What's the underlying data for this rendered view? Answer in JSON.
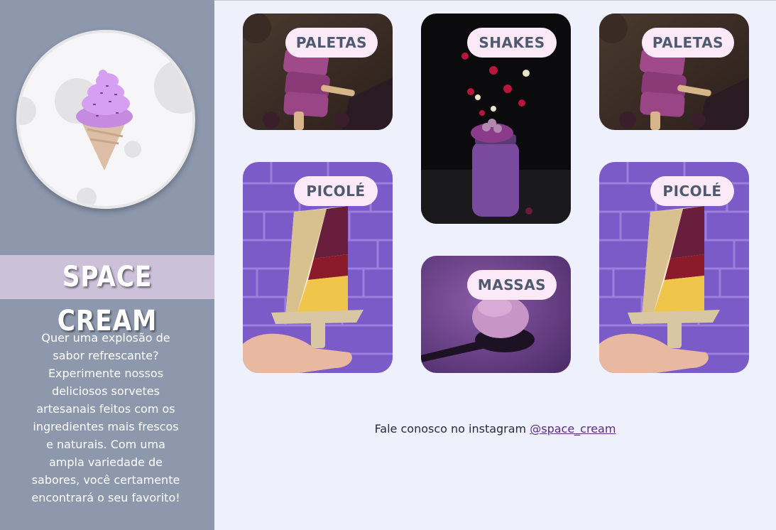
{
  "brand": {
    "name": "SPACE CREAM",
    "description": "Quer uma explosão de sabor refrescante? Experimente nossos deliciosos sorvetes artesanais feitos com os ingredientes mais frescos e naturais. Com uma ampla variedade de sabores, você certamente encontrará o seu favorito!"
  },
  "cards": [
    {
      "label": "PALETAS",
      "image": "paletas-photo"
    },
    {
      "label": "SHAKES",
      "image": "shakes-photo"
    },
    {
      "label": "PALETAS",
      "image": "paletas-photo"
    },
    {
      "label": "PICOLÉ",
      "image": "picole-photo"
    },
    {
      "label": "MASSAS",
      "image": "massas-photo"
    },
    {
      "label": "PICOLÉ",
      "image": "picole-photo"
    }
  ],
  "footer": {
    "text": "Fale conosco no instagram ",
    "instagram_handle": "@space_cream"
  },
  "colors": {
    "sidebar": "#8d98ad",
    "brand_band": "#cdc1da",
    "page_background": "#eef0fb",
    "label_background": "#fbe9f7",
    "label_text": "#4f5a70",
    "link": "#5b2c83"
  }
}
